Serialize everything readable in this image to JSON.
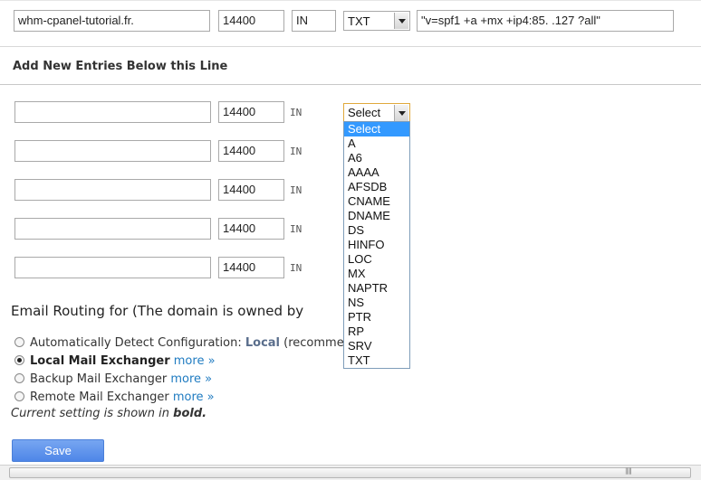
{
  "existing_row": {
    "name": "whm-cpanel-tutorial.fr.",
    "ttl": "14400",
    "class": "IN",
    "type": "TXT",
    "record": "\"v=spf1 +a +mx +ip4:85.            .127 ?all\""
  },
  "new_entries": {
    "heading": "Add New Entries Below this Line",
    "rows": [
      {
        "name": "",
        "ttl": "14400",
        "class": "IN",
        "type": "Select"
      },
      {
        "name": "",
        "ttl": "14400",
        "class": "IN"
      },
      {
        "name": "",
        "ttl": "14400",
        "class": "IN"
      },
      {
        "name": "",
        "ttl": "14400",
        "class": "IN"
      },
      {
        "name": "",
        "ttl": "14400",
        "class": "IN"
      }
    ]
  },
  "type_dropdown": {
    "options": [
      "Select",
      "A",
      "A6",
      "AAAA",
      "AFSDB",
      "CNAME",
      "DNAME",
      "DS",
      "HINFO",
      "LOC",
      "MX",
      "NAPTR",
      "NS",
      "PTR",
      "RP",
      "SRV",
      "TXT"
    ],
    "highlighted": "Select"
  },
  "email_routing": {
    "heading": "Email Routing for (The domain is owned by",
    "options": [
      {
        "label": "Automatically Detect Configuration:",
        "value": "Local",
        "suffix": "(recommen",
        "checked": false
      },
      {
        "label": "Local Mail Exchanger",
        "more": "more »",
        "checked": true
      },
      {
        "label": "Backup Mail Exchanger",
        "more": "more »",
        "checked": false
      },
      {
        "label": "Remote Mail Exchanger",
        "more": "more »",
        "checked": false
      }
    ],
    "note_prefix": "Current setting is shown in",
    "note_bold": "bold."
  },
  "save_label": "Save",
  "colors": {
    "accent": "#4e86e8",
    "link": "#1f7bc1",
    "dropdown_highlight": "#3399ff"
  }
}
